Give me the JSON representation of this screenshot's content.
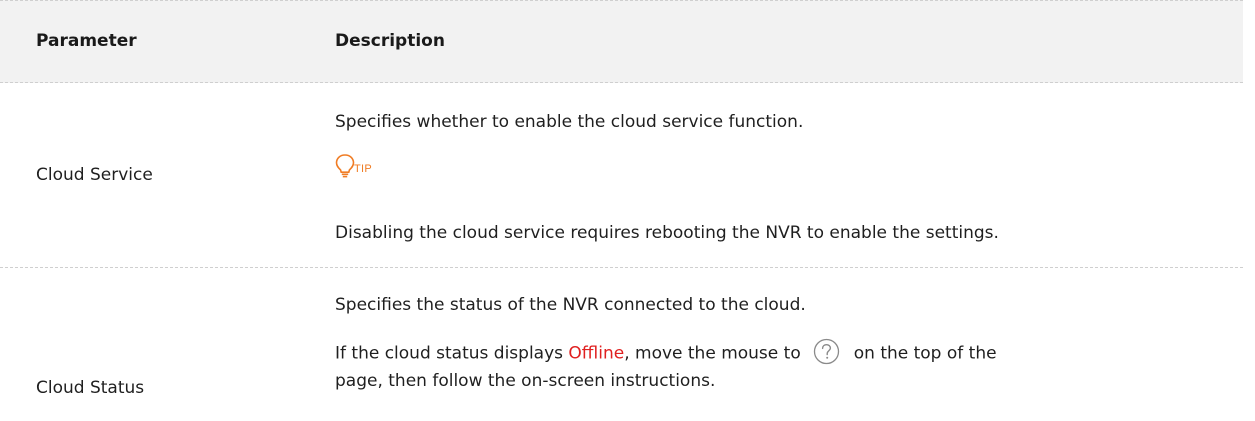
{
  "table": {
    "headers": {
      "parameter": "Parameter",
      "description": "Description"
    },
    "rows": [
      {
        "parameter": "Cloud Service",
        "desc_line1": "Specifies whether to enable the cloud service function.",
        "tip_label": "TIP",
        "tip_text": "Disabling the cloud service requires rebooting the NVR to enable the settings."
      },
      {
        "parameter": "Cloud Status",
        "desc_line1": "Specifies the status of the NVR connected to the cloud.",
        "desc_line2_pre": "If the cloud status displays ",
        "desc_line2_highlight": "Offline",
        "desc_line2_mid": ", move the mouse to",
        "desc_line2_post": "on the top of the",
        "desc_line3": "page, then follow the on-screen instructions.",
        "help_icon": "question-circle-icon"
      }
    ]
  },
  "colors": {
    "header_bg": "#f2f2f2",
    "tip_orange": "#f07c24",
    "highlight_red": "#e02020"
  }
}
